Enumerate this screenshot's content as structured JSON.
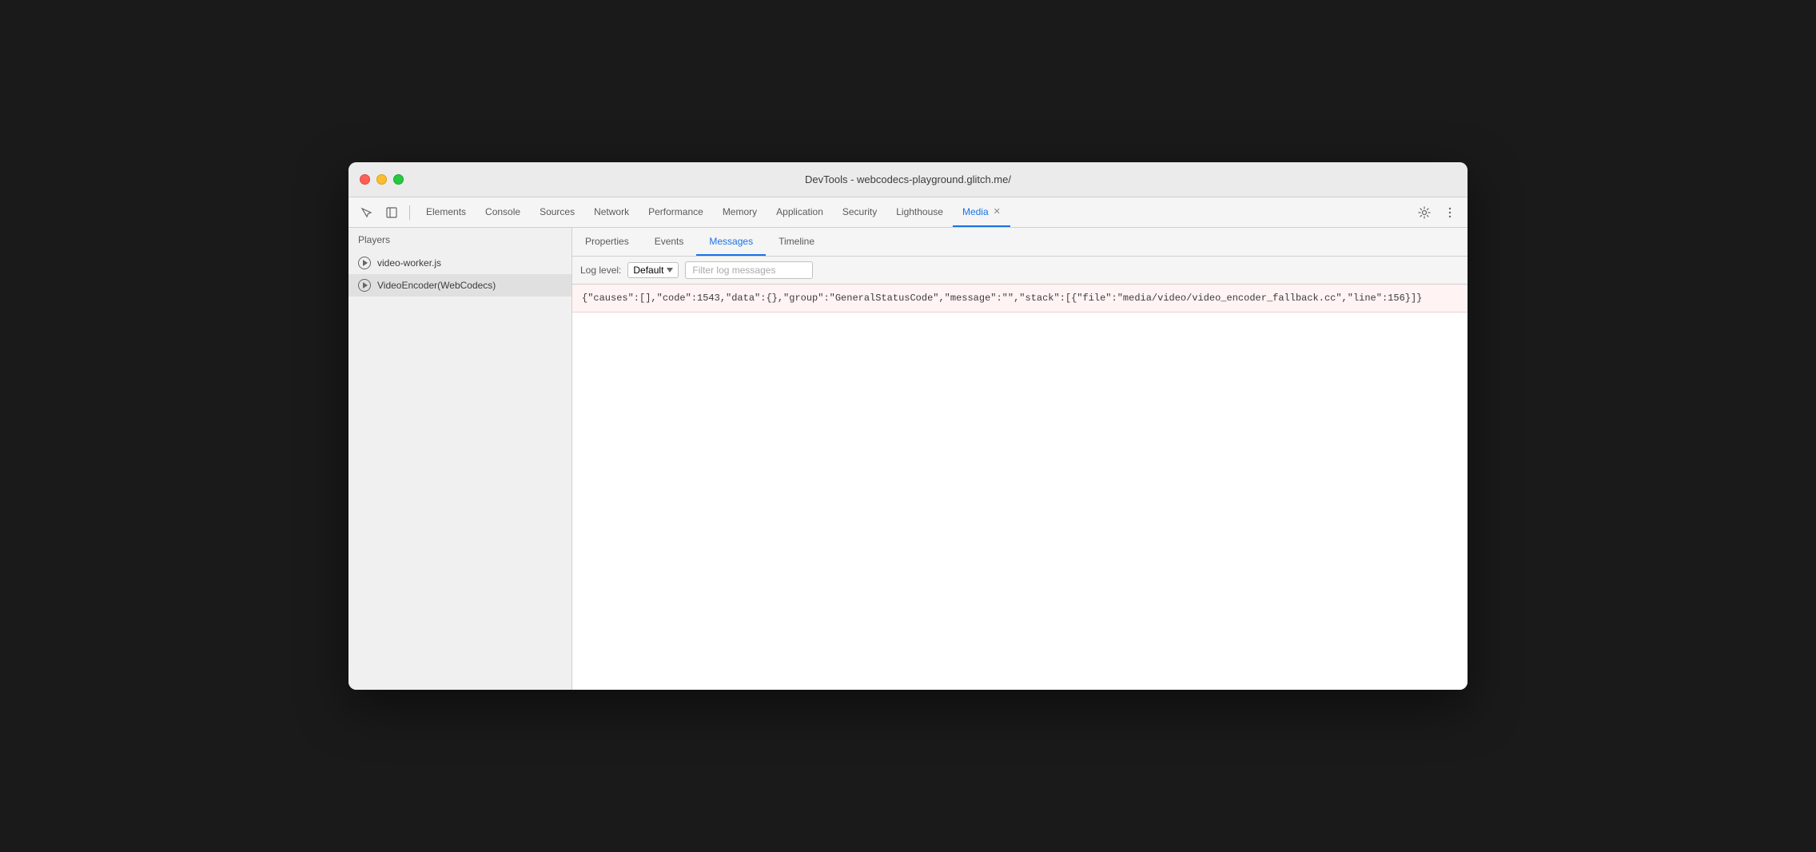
{
  "window": {
    "title": "DevTools - webcodecs-playground.glitch.me/"
  },
  "traffic_lights": {
    "close_label": "close",
    "minimize_label": "minimize",
    "maximize_label": "maximize"
  },
  "toolbar": {
    "cursor_icon": "cursor",
    "dock_icon": "dock",
    "tabs": [
      {
        "label": "Elements",
        "active": false
      },
      {
        "label": "Console",
        "active": false
      },
      {
        "label": "Sources",
        "active": false
      },
      {
        "label": "Network",
        "active": false
      },
      {
        "label": "Performance",
        "active": false
      },
      {
        "label": "Memory",
        "active": false
      },
      {
        "label": "Application",
        "active": false
      },
      {
        "label": "Security",
        "active": false
      },
      {
        "label": "Lighthouse",
        "active": false
      },
      {
        "label": "Media",
        "active": true,
        "closeable": true
      }
    ],
    "settings_icon": "settings",
    "more_icon": "more-vertical"
  },
  "sidebar": {
    "header": "Players",
    "items": [
      {
        "label": "video-worker.js",
        "selected": false
      },
      {
        "label": "VideoEncoder(WebCodecs)",
        "selected": true
      }
    ]
  },
  "panel": {
    "sub_tabs": [
      {
        "label": "Properties",
        "active": false
      },
      {
        "label": "Events",
        "active": false
      },
      {
        "label": "Messages",
        "active": true
      },
      {
        "label": "Timeline",
        "active": false
      }
    ],
    "filter_bar": {
      "log_level_label": "Log level:",
      "log_level_value": "Default",
      "filter_placeholder": "Filter log messages"
    },
    "messages": [
      {
        "text": "{\"causes\":[],\"code\":1543,\"data\":{},\"group\":\"GeneralStatusCode\",\"message\":\"\",\"stack\":[{\"file\":\"media/video/video_encoder_fallback.cc\",\"line\":156}]}",
        "type": "error"
      }
    ]
  }
}
